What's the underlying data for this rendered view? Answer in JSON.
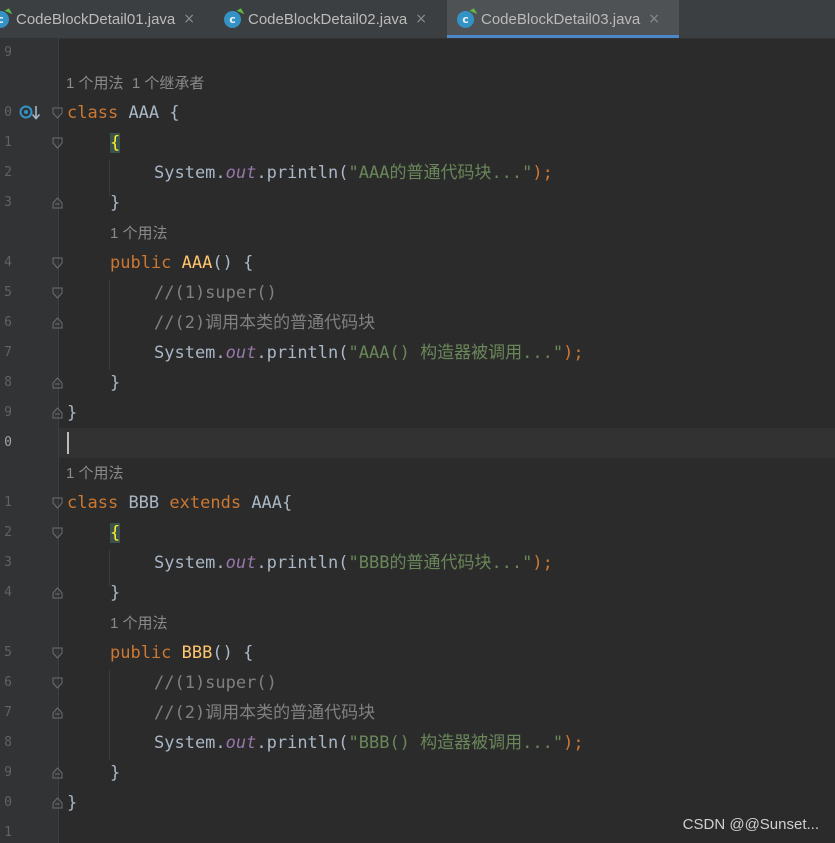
{
  "tabs": [
    {
      "label": "CodeBlockDetail01.java",
      "active": false
    },
    {
      "label": "CodeBlockDetail02.java",
      "active": false
    },
    {
      "label": "CodeBlockDetail03.java",
      "active": true
    }
  ],
  "tab_icon_letter": "c",
  "tab_close_glyph": "×",
  "line_numbers": [
    "9",
    "",
    "0",
    "1",
    "2",
    "3",
    "",
    "4",
    "5",
    "6",
    "7",
    "8",
    "9",
    "0",
    "",
    "1",
    "2",
    "3",
    "4",
    "",
    "5",
    "6",
    "7",
    "8",
    "9",
    "0",
    "1"
  ],
  "hints": {
    "usages_aaa": "1 个用法",
    "inheritors_aaa": "1 个继承者",
    "usages_aaa_ctor": "1 个用法",
    "usages_bbb": "1 个用法",
    "usages_bbb_ctor": "1 个用法"
  },
  "code": {
    "class_kw": "class",
    "extends_kw": "extends",
    "public_kw": "public",
    "class_aaa": "AAA",
    "class_bbb": "BBB",
    "open_brace": "{",
    "close_brace": "}",
    "system": "System.",
    "out": "out",
    "println": ".println(",
    "close_call": ");",
    "ctor_parens": "() {",
    "str_aaa_block": "\"AAA的普通代码块...\"",
    "str_aaa_ctor": "\"AAA() 构造器被调用...\"",
    "str_bbb_block": "\"BBB的普通代码块...\"",
    "str_bbb_ctor": "\"BBB() 构造器被调用...\"",
    "comment_super": "//(1)super()",
    "comment_call": "//(2)调用本类的普通代码块"
  },
  "watermark": "CSDN @@Sunset...",
  "colors": {
    "background": "#2b2b2b",
    "keyword": "#cc7832",
    "method_decl": "#ffc66d",
    "static_field": "#9876aa",
    "string": "#6a8759",
    "comment": "#808080",
    "tab_underline": "#4a88c7"
  }
}
